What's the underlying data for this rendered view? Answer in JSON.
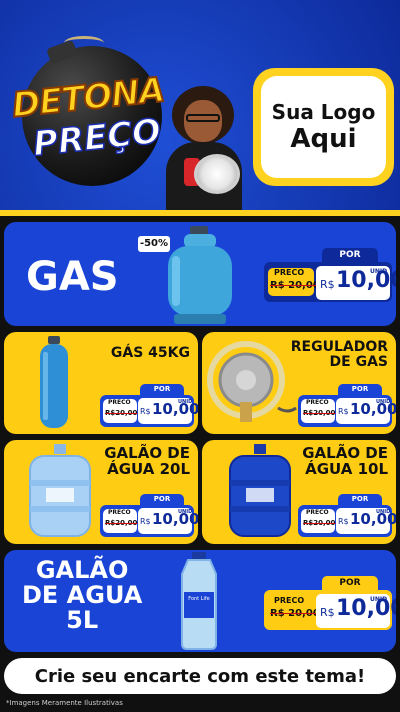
{
  "header": {
    "title_line1": "DETONA",
    "title_line2": "PREÇO",
    "logo_line1": "Sua Logo",
    "logo_line2": "Aqui"
  },
  "products": [
    {
      "id": "gas",
      "name": "GAS",
      "discount": "-50%",
      "price_label": "PRECO",
      "old_price": "R$ 20,00",
      "por": "POR",
      "currency": "R$",
      "price": "10,00",
      "unit": "UNID"
    },
    {
      "id": "gas45",
      "name_line1": "GÁS 45KG",
      "price_label": "PRECO",
      "old_price": "R$20,00",
      "por": "POR",
      "currency": "R$",
      "price": "10,00",
      "unit": "UNID"
    },
    {
      "id": "regulador",
      "name_line1": "REGULADOR",
      "name_line2": "DE GAS",
      "price_label": "PRECO",
      "old_price": "R$20,00",
      "por": "POR",
      "currency": "R$",
      "price": "10,00",
      "unit": "UNID"
    },
    {
      "id": "galao20",
      "name_line1": "GALÃO DE",
      "name_line2": "ÁGUA 20L",
      "price_label": "PRECO",
      "old_price": "R$20,00",
      "por": "POR",
      "currency": "R$",
      "price": "10,00",
      "unit": "UNID"
    },
    {
      "id": "galao10",
      "name_line1": "GALÃO DE",
      "name_line2": "ÁGUA 10L",
      "price_label": "PRECO",
      "old_price": "R$20,00",
      "por": "POR",
      "currency": "R$",
      "price": "10,00",
      "unit": "UNID"
    },
    {
      "id": "galao5",
      "name_line1": "GALÃO",
      "name_line2": "DE AGUA",
      "name_line3": "5L",
      "bottle_brand": "Font Life",
      "price_label": "PRECO",
      "old_price": "R$ 20,00",
      "por": "POR",
      "currency": "R$",
      "price": "10,00",
      "unit": "UNID"
    }
  ],
  "cta": "Crie seu encarte com este tema!",
  "disclaimer": "*Imagens Meramente Ilustrativas",
  "colors": {
    "blue": "#1a44d6",
    "navy": "#0e2a9a",
    "yellow": "#ffcc14",
    "white": "#ffffff"
  }
}
